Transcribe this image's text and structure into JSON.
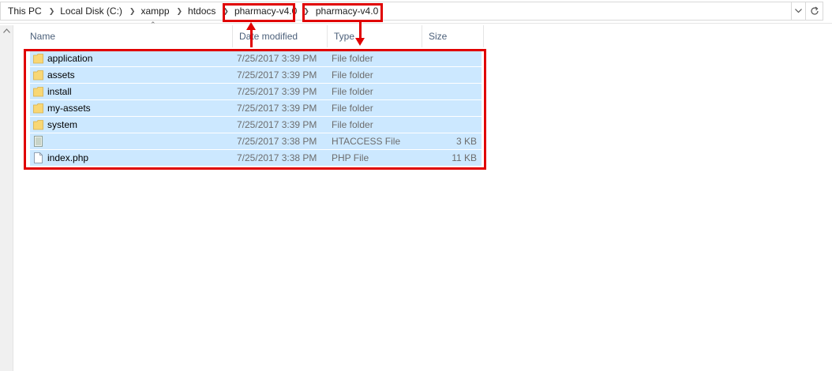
{
  "breadcrumb": {
    "items": [
      "This PC",
      "Local Disk (C:)",
      "xampp",
      "htdocs",
      "pharmacy-v4.0",
      "pharmacy-v4.0"
    ]
  },
  "columns": {
    "name": "Name",
    "date": "Date modified",
    "type": "Type",
    "size": "Size"
  },
  "files": [
    {
      "name": "application",
      "date": "7/25/2017 3:39 PM",
      "type": "File folder",
      "size": "",
      "icon": "folder-icon"
    },
    {
      "name": "assets",
      "date": "7/25/2017 3:39 PM",
      "type": "File folder",
      "size": "",
      "icon": "folder-icon"
    },
    {
      "name": "install",
      "date": "7/25/2017 3:39 PM",
      "type": "File folder",
      "size": "",
      "icon": "folder-icon"
    },
    {
      "name": "my-assets",
      "date": "7/25/2017 3:39 PM",
      "type": "File folder",
      "size": "",
      "icon": "folder-icon"
    },
    {
      "name": "system",
      "date": "7/25/2017 3:39 PM",
      "type": "File folder",
      "size": "",
      "icon": "folder-icon"
    },
    {
      "name": "",
      "date": "7/25/2017 3:38 PM",
      "type": "HTACCESS File",
      "size": "3 KB",
      "icon": "text-file-icon"
    },
    {
      "name": "index.php",
      "date": "7/25/2017 3:38 PM",
      "type": "PHP File",
      "size": "11 KB",
      "icon": "file-icon"
    }
  ],
  "colors": {
    "selection": "#cce8ff",
    "annotation": "#e00000",
    "header_text": "#4c607a"
  }
}
